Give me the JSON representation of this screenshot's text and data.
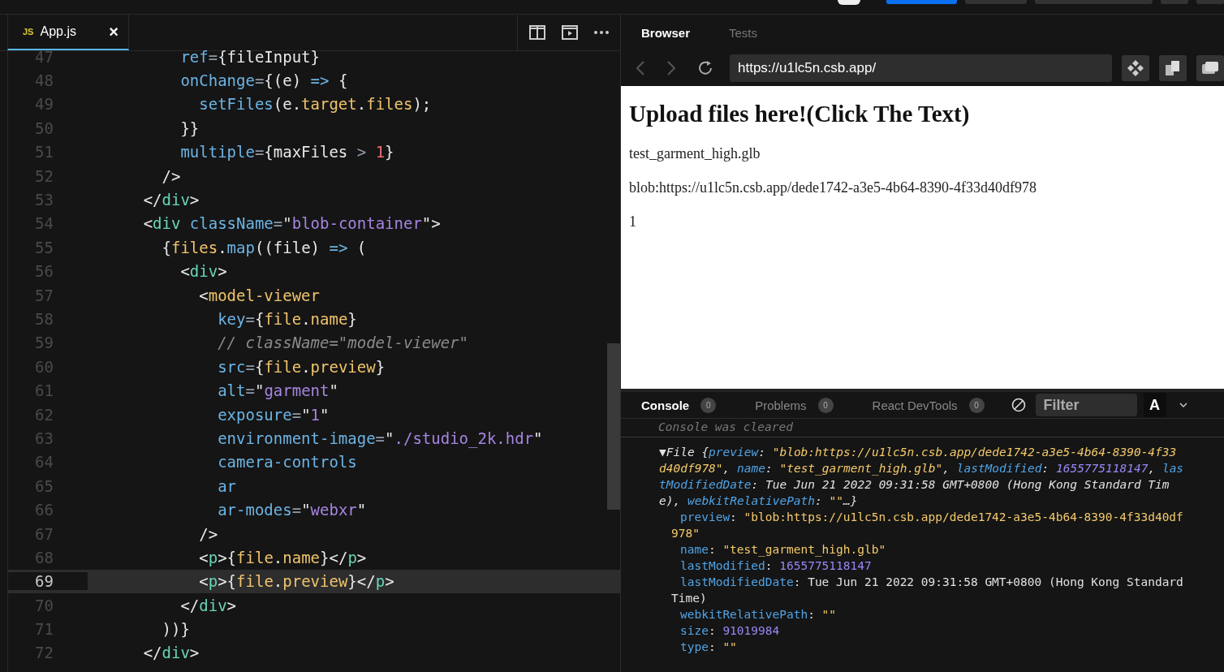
{
  "editor": {
    "tab": {
      "badge": "JS",
      "label": "App.js",
      "close": "×",
      "selected": true
    },
    "lines": [
      {
        "number": "47",
        "current": false,
        "tokens": [
          {
            "kind": "attr",
            "text": "          ref"
          },
          {
            "kind": "op",
            "text": "="
          },
          {
            "kind": "punct",
            "text": "{fileInput}"
          }
        ]
      },
      {
        "number": "48",
        "current": false,
        "tokens": [
          {
            "kind": "attr",
            "text": "          onChange"
          },
          {
            "kind": "op",
            "text": "="
          },
          {
            "kind": "punct",
            "text": "{(e) "
          },
          {
            "kind": "attr",
            "text": "=>"
          },
          {
            "kind": "punct",
            "text": " {"
          }
        ]
      },
      {
        "number": "49",
        "current": false,
        "tokens": [
          {
            "kind": "attr",
            "text": "            setFiles"
          },
          {
            "kind": "punct",
            "text": "(e."
          },
          {
            "kind": "var",
            "text": "target"
          },
          {
            "kind": "punct",
            "text": "."
          },
          {
            "kind": "var",
            "text": "files"
          },
          {
            "kind": "punct",
            "text": ");"
          }
        ]
      },
      {
        "number": "50",
        "current": false,
        "tokens": [
          {
            "kind": "punct",
            "text": "          }}"
          }
        ]
      },
      {
        "number": "51",
        "current": false,
        "tokens": [
          {
            "kind": "attr",
            "text": "          multiple"
          },
          {
            "kind": "op",
            "text": "="
          },
          {
            "kind": "punct",
            "text": "{maxFiles "
          },
          {
            "kind": "op",
            "text": "> "
          },
          {
            "kind": "num",
            "text": "1"
          },
          {
            "kind": "punct",
            "text": "}"
          }
        ]
      },
      {
        "number": "52",
        "current": false,
        "tokens": [
          {
            "kind": "punct",
            "text": "        />"
          }
        ]
      },
      {
        "number": "53",
        "current": false,
        "tokens": [
          {
            "kind": "punct",
            "text": "      </"
          },
          {
            "kind": "tag",
            "text": "div"
          },
          {
            "kind": "punct",
            "text": ">"
          }
        ]
      },
      {
        "number": "54",
        "current": false,
        "tokens": [
          {
            "kind": "punct",
            "text": "      <"
          },
          {
            "kind": "tag",
            "text": "div"
          },
          {
            "kind": "attr",
            "text": " className"
          },
          {
            "kind": "op",
            "text": "="
          },
          {
            "kind": "punct",
            "text": "\""
          },
          {
            "kind": "string",
            "text": "blob-container"
          },
          {
            "kind": "punct",
            "text": "\">"
          }
        ]
      },
      {
        "number": "55",
        "current": false,
        "tokens": [
          {
            "kind": "punct",
            "text": "        {"
          },
          {
            "kind": "var",
            "text": "files"
          },
          {
            "kind": "punct",
            "text": "."
          },
          {
            "kind": "attr",
            "text": "map"
          },
          {
            "kind": "punct",
            "text": "((file) "
          },
          {
            "kind": "attr",
            "text": "=>"
          },
          {
            "kind": "punct",
            "text": " ("
          }
        ]
      },
      {
        "number": "56",
        "current": false,
        "tokens": [
          {
            "kind": "punct",
            "text": "          <"
          },
          {
            "kind": "tag",
            "text": "div"
          },
          {
            "kind": "punct",
            "text": ">"
          }
        ]
      },
      {
        "number": "57",
        "current": false,
        "tokens": [
          {
            "kind": "punct",
            "text": "            <"
          },
          {
            "kind": "var",
            "text": "model-viewer"
          }
        ]
      },
      {
        "number": "58",
        "current": false,
        "tokens": [
          {
            "kind": "attr",
            "text": "              key"
          },
          {
            "kind": "op",
            "text": "="
          },
          {
            "kind": "punct",
            "text": "{"
          },
          {
            "kind": "var",
            "text": "file"
          },
          {
            "kind": "punct",
            "text": "."
          },
          {
            "kind": "var",
            "text": "name"
          },
          {
            "kind": "punct",
            "text": "}"
          }
        ]
      },
      {
        "number": "59",
        "current": false,
        "tokens": [
          {
            "kind": "comment",
            "text": "              // className=\"model-viewer\""
          }
        ]
      },
      {
        "number": "60",
        "current": false,
        "tokens": [
          {
            "kind": "attr",
            "text": "              src"
          },
          {
            "kind": "op",
            "text": "="
          },
          {
            "kind": "punct",
            "text": "{"
          },
          {
            "kind": "var",
            "text": "file"
          },
          {
            "kind": "punct",
            "text": "."
          },
          {
            "kind": "var",
            "text": "preview"
          },
          {
            "kind": "punct",
            "text": "}"
          }
        ]
      },
      {
        "number": "61",
        "current": false,
        "tokens": [
          {
            "kind": "attr",
            "text": "              alt"
          },
          {
            "kind": "op",
            "text": "="
          },
          {
            "kind": "punct",
            "text": "\""
          },
          {
            "kind": "string",
            "text": "garment"
          },
          {
            "kind": "punct",
            "text": "\""
          }
        ]
      },
      {
        "number": "62",
        "current": false,
        "tokens": [
          {
            "kind": "attr",
            "text": "              exposure"
          },
          {
            "kind": "op",
            "text": "="
          },
          {
            "kind": "punct",
            "text": "\""
          },
          {
            "kind": "string",
            "text": "1"
          },
          {
            "kind": "punct",
            "text": "\""
          }
        ]
      },
      {
        "number": "63",
        "current": false,
        "tokens": [
          {
            "kind": "attr",
            "text": "              environment-image"
          },
          {
            "kind": "op",
            "text": "="
          },
          {
            "kind": "punct",
            "text": "\""
          },
          {
            "kind": "string",
            "text": "./studio_2k.hdr"
          },
          {
            "kind": "punct",
            "text": "\""
          }
        ]
      },
      {
        "number": "64",
        "current": false,
        "tokens": [
          {
            "kind": "attr",
            "text": "              camera-controls"
          }
        ]
      },
      {
        "number": "65",
        "current": false,
        "tokens": [
          {
            "kind": "attr",
            "text": "              ar"
          }
        ]
      },
      {
        "number": "66",
        "current": false,
        "tokens": [
          {
            "kind": "attr",
            "text": "              ar-modes"
          },
          {
            "kind": "op",
            "text": "="
          },
          {
            "kind": "punct",
            "text": "\""
          },
          {
            "kind": "string",
            "text": "webxr"
          },
          {
            "kind": "punct",
            "text": "\""
          }
        ]
      },
      {
        "number": "67",
        "current": false,
        "tokens": [
          {
            "kind": "punct",
            "text": "            />"
          }
        ]
      },
      {
        "number": "68",
        "current": false,
        "tokens": [
          {
            "kind": "punct",
            "text": "            <"
          },
          {
            "kind": "tag",
            "text": "p"
          },
          {
            "kind": "punct",
            "text": ">{"
          },
          {
            "kind": "var",
            "text": "file"
          },
          {
            "kind": "punct",
            "text": "."
          },
          {
            "kind": "var",
            "text": "name"
          },
          {
            "kind": "punct",
            "text": "}</"
          },
          {
            "kind": "tag",
            "text": "p"
          },
          {
            "kind": "punct",
            "text": ">"
          }
        ]
      },
      {
        "number": "69",
        "current": true,
        "tokens": [
          {
            "kind": "punct",
            "text": "            <"
          },
          {
            "kind": "tag",
            "text": "p"
          },
          {
            "kind": "punct",
            "text": ">{"
          },
          {
            "kind": "var",
            "text": "file"
          },
          {
            "kind": "punct",
            "text": "."
          },
          {
            "kind": "var",
            "text": "preview"
          },
          {
            "kind": "punct",
            "text": "}</"
          },
          {
            "kind": "tag",
            "text": "p"
          },
          {
            "kind": "punct",
            "text": ">"
          }
        ]
      },
      {
        "number": "70",
        "current": false,
        "tokens": [
          {
            "kind": "punct",
            "text": "          </"
          },
          {
            "kind": "tag",
            "text": "div"
          },
          {
            "kind": "punct",
            "text": ">"
          }
        ]
      },
      {
        "number": "71",
        "current": false,
        "tokens": [
          {
            "kind": "punct",
            "text": "        ))}"
          }
        ]
      },
      {
        "number": "72",
        "current": false,
        "tokens": [
          {
            "kind": "punct",
            "text": "      </"
          },
          {
            "kind": "tag",
            "text": "div"
          },
          {
            "kind": "punct",
            "text": ">"
          }
        ]
      }
    ]
  },
  "preview": {
    "tabs": [
      {
        "label": "Browser",
        "selected": true
      },
      {
        "label": "Tests",
        "selected": false
      }
    ],
    "url": "https://u1lc5n.csb.app/",
    "page": {
      "heading": "Upload files here!(Click The Text)",
      "paragraphs": [
        "test_garment_high.glb",
        "blob:https://u1lc5n.csb.app/dede1742-a3e5-4b64-8390-4f33d40df978",
        "1"
      ]
    },
    "console_tabs": [
      {
        "label": "Console",
        "count": "0",
        "selected": true
      },
      {
        "label": "Problems",
        "count": "0",
        "selected": false
      },
      {
        "label": "React DevTools",
        "count": "0",
        "selected": false
      }
    ],
    "filter": {
      "placeholder": "Filter"
    },
    "font_button": "A",
    "cleared": "Console was cleared",
    "log": [
      {
        "kind": "summary",
        "tokens": [
          {
            "kind": "plain",
            "text": "▼File {"
          },
          {
            "kind": "key",
            "text": "preview"
          },
          {
            "kind": "plain",
            "text": ": "
          },
          {
            "kind": "str",
            "text": "\"blob:https://u1lc5n.csb.app/dede1742-a3e5-4b64-8390-4f33"
          }
        ]
      },
      {
        "kind": "summary",
        "tokens": [
          {
            "kind": "str",
            "text": "d40df978\""
          },
          {
            "kind": "plain",
            "text": ", "
          },
          {
            "kind": "key",
            "text": "name"
          },
          {
            "kind": "plain",
            "text": ": "
          },
          {
            "kind": "str",
            "text": "\"test_garment_high.glb\""
          },
          {
            "kind": "plain",
            "text": ", "
          },
          {
            "kind": "key",
            "text": "lastModified"
          },
          {
            "kind": "plain",
            "text": ": "
          },
          {
            "kind": "num",
            "text": "1655775118147"
          },
          {
            "kind": "plain",
            "text": ", "
          },
          {
            "kind": "key",
            "text": "las"
          }
        ]
      },
      {
        "kind": "summary",
        "tokens": [
          {
            "kind": "key",
            "text": "tModifiedDate"
          },
          {
            "kind": "plain",
            "text": ": Tue Jun 21 2022 09:31:58 GMT+0800 (Hong Kong Standard Tim"
          }
        ]
      },
      {
        "kind": "summary",
        "tokens": [
          {
            "kind": "plain",
            "text": "e), "
          },
          {
            "kind": "key",
            "text": "webkitRelativePath"
          },
          {
            "kind": "plain",
            "text": ": "
          },
          {
            "kind": "str",
            "text": "\"\""
          },
          {
            "kind": "plain",
            "text": "…}"
          }
        ]
      },
      {
        "kind": "prop",
        "tokens": [
          {
            "kind": "key",
            "text": "preview"
          },
          {
            "kind": "plain",
            "text": ": "
          },
          {
            "kind": "str",
            "text": "\"blob:https://u1lc5n.csb.app/dede1742-a3e5-4b64-8390-4f33d40df"
          }
        ]
      },
      {
        "kind": "wrap",
        "tokens": [
          {
            "kind": "str",
            "text": "978\""
          }
        ]
      },
      {
        "kind": "prop",
        "tokens": [
          {
            "kind": "key",
            "text": "name"
          },
          {
            "kind": "plain",
            "text": ": "
          },
          {
            "kind": "str",
            "text": "\"test_garment_high.glb\""
          }
        ]
      },
      {
        "kind": "prop",
        "tokens": [
          {
            "kind": "key",
            "text": "lastModified"
          },
          {
            "kind": "plain",
            "text": ": "
          },
          {
            "kind": "num",
            "text": "1655775118147"
          }
        ]
      },
      {
        "kind": "prop",
        "tokens": [
          {
            "kind": "key",
            "text": "lastModifiedDate"
          },
          {
            "kind": "plain",
            "text": ": Tue Jun 21 2022 09:31:58 GMT+0800 (Hong Kong Standard"
          }
        ]
      },
      {
        "kind": "wrap",
        "tokens": [
          {
            "kind": "plain",
            "text": "Time)"
          }
        ]
      },
      {
        "kind": "prop",
        "tokens": [
          {
            "kind": "key",
            "text": "webkitRelativePath"
          },
          {
            "kind": "plain",
            "text": ": "
          },
          {
            "kind": "str",
            "text": "\"\""
          }
        ]
      },
      {
        "kind": "prop",
        "tokens": [
          {
            "kind": "key",
            "text": "size"
          },
          {
            "kind": "plain",
            "text": ": "
          },
          {
            "kind": "num",
            "text": "91019984"
          }
        ]
      },
      {
        "kind": "prop",
        "tokens": [
          {
            "kind": "key",
            "text": "type"
          },
          {
            "kind": "plain",
            "text": ": "
          },
          {
            "kind": "str",
            "text": "\"\""
          }
        ]
      }
    ]
  }
}
